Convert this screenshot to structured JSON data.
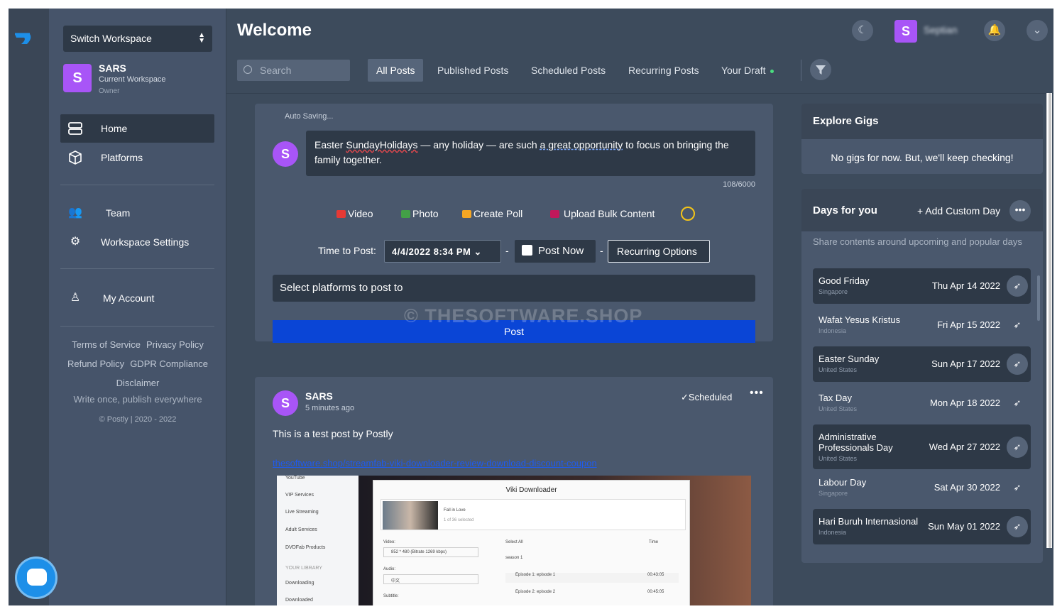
{
  "sidebar": {
    "workspace_switch": "Switch Workspace",
    "workspace": {
      "avatar": "S",
      "name": "SARS",
      "subtitle": "Current Workspace",
      "role": "Owner"
    },
    "nav": [
      {
        "label": "Home",
        "icon": "server-icon"
      },
      {
        "label": "Platforms",
        "icon": "cube-icon"
      },
      {
        "label": "Team",
        "icon": "team-icon"
      },
      {
        "label": "Workspace Settings",
        "icon": "gear-icon"
      },
      {
        "label": "My Account",
        "icon": "user-icon"
      }
    ],
    "links": [
      "Terms of Service",
      "Privacy Policy",
      "Refund Policy",
      "GDPR Compliance",
      "Disclaimer"
    ],
    "tagline": "Write once, publish everywhere",
    "copyright": "© Postly | 2020 - 2022"
  },
  "header": {
    "title": "Welcome",
    "user_avatar": "S",
    "user_name": "Septian",
    "search_placeholder": "Search",
    "tabs": [
      "All Posts",
      "Published Posts",
      "Scheduled Posts",
      "Recurring Posts",
      "Your Draft"
    ]
  },
  "composer": {
    "autosave": "Auto Saving...",
    "avatar": "S",
    "text_parts": [
      "Easter ",
      "SundayHolidays",
      " — any holiday — are such ",
      "a great opportunity",
      " to focus on bringing the family together."
    ],
    "counter": "108/6000",
    "media": [
      "Video",
      "Photo",
      "Create Poll",
      "Upload Bulk Content"
    ],
    "time_label": "Time to Post:",
    "time_value": "4/4/2022 8:34  PM",
    "post_now": "Post Now",
    "recurring": "Recurring Options",
    "platforms": "Select platforms to post to",
    "post_button": "Post",
    "watermark": "© THESOFTWARE.SHOP"
  },
  "post": {
    "avatar": "S",
    "author": "SARS",
    "time": "5 minutes ago",
    "status": "Scheduled",
    "text": "This is a test post by Postly",
    "link": "thesoftware.shop/streamfab-viki-downloader-review-download-discount-coupon",
    "preview": {
      "side_items": [
        "YouTube",
        "VIP Services",
        "Live Streaming",
        "Adult Services",
        "DVDFab Products",
        "YOUR LIBRARY",
        "Downloading",
        "Downloaded"
      ],
      "dialog_title": "Viki Downloader",
      "item_title": "Fall in Love",
      "item_sub": "1 of 36 selected",
      "video_label": "Video:",
      "video_value": "852 * 480 (Bitrate 1269 kbps)",
      "audio_label": "Audio:",
      "audio_value": "中文",
      "subtitle_label": "Subtitle:",
      "select_all": "Select All",
      "time_col": "Time",
      "season": "season 1",
      "episodes": [
        {
          "name": "Episode 1: episode 1",
          "time": "00:43:05"
        },
        {
          "name": "Episode 2: episode 2",
          "time": "00:45:05"
        }
      ]
    }
  },
  "gigs": {
    "title": "Explore Gigs",
    "message": "No gigs for now. But, we'll keep checking!"
  },
  "days": {
    "title": "Days for you",
    "add": "+ Add Custom Day",
    "description": "Share contents around upcoming and popular days",
    "items": [
      {
        "name": "Good Friday",
        "country": "Singapore",
        "date": "Thu Apr 14 2022"
      },
      {
        "name": "Wafat Yesus Kristus",
        "country": "Indonesia",
        "date": "Fri Apr 15 2022"
      },
      {
        "name": "Easter Sunday",
        "country": "United States",
        "date": "Sun Apr 17 2022"
      },
      {
        "name": "Tax Day",
        "country": "United States",
        "date": "Mon Apr 18 2022"
      },
      {
        "name": "Administrative Professionals Day",
        "country": "United States",
        "date": "Wed Apr 27 2022"
      },
      {
        "name": "Labour Day",
        "country": "Singapore",
        "date": "Sat Apr 30 2022"
      },
      {
        "name": "Hari Buruh Internasional",
        "country": "Indonesia",
        "date": "Sun May 01 2022"
      }
    ]
  },
  "colors": {
    "accent": "#a855f7",
    "post_button": "#0a45d6",
    "background": "#3d4b5c",
    "sidebar": "#46546a"
  }
}
